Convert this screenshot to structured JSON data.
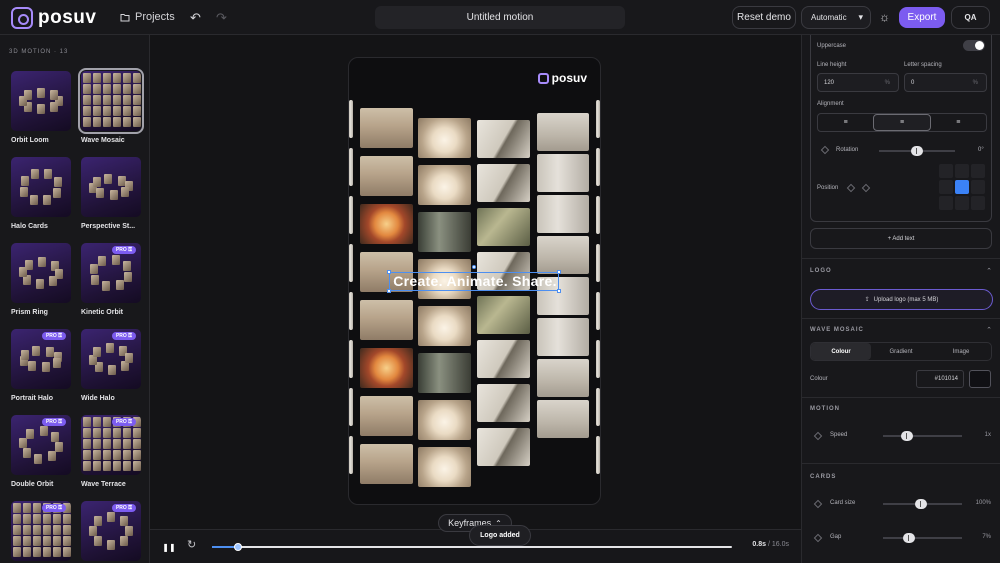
{
  "topbar": {
    "brand": "posuv",
    "projects_label": "Projects",
    "document_title": "Untitled motion",
    "reset_label": "Reset demo",
    "quality_value": "Automatic",
    "export_label": "Export",
    "qa_label": "QA"
  },
  "left_panel": {
    "section_label": "3D MOTION · 13",
    "pro_badge": "PRO ⚿",
    "presets": [
      {
        "label": "Orbit Loom",
        "pro": false,
        "selected": false
      },
      {
        "label": "Wave Mosaic",
        "pro": false,
        "selected": true
      },
      {
        "label": "Halo Cards",
        "pro": false,
        "selected": false
      },
      {
        "label": "Perspective St...",
        "pro": false,
        "selected": false
      },
      {
        "label": "Prism Ring",
        "pro": false,
        "selected": false
      },
      {
        "label": "Kinetic Orbit",
        "pro": true,
        "selected": false
      },
      {
        "label": "Portrait Halo",
        "pro": true,
        "selected": false
      },
      {
        "label": "Wide Halo",
        "pro": true,
        "selected": false
      },
      {
        "label": "Double Orbit",
        "pro": true,
        "selected": false
      },
      {
        "label": "Wave Terrace",
        "pro": true,
        "selected": false
      },
      {
        "label": "",
        "pro": true,
        "selected": false
      },
      {
        "label": "",
        "pro": true,
        "selected": false
      }
    ]
  },
  "canvas": {
    "brand": "posuv",
    "overlay_text": "Create. Animate. Share.",
    "keyframes_label": "Keyframes",
    "toast": "Logo added"
  },
  "timeline": {
    "current_time": "0.8s",
    "total_time": "/ 16.0s",
    "progress": 0.05
  },
  "right_panel": {
    "text_settings": {
      "uppercase_label": "Uppercase",
      "uppercase_on": false,
      "line_height_label": "Line height",
      "line_height_value": "120",
      "line_height_unit": "%",
      "letter_spacing_label": "Letter spacing",
      "letter_spacing_value": "0",
      "letter_spacing_unit": "%",
      "alignment_label": "Alignment",
      "rotation_label": "Rotation",
      "rotation_value": "0°",
      "position_label": "Position",
      "add_text_label": "+ Add text"
    },
    "logo": {
      "header": "LOGO",
      "upload_label": "Upload logo (max 5 MB)"
    },
    "wave_mosaic": {
      "header": "WAVE MOSAIC",
      "tabs": [
        "Colour",
        "Gradient",
        "Image"
      ],
      "active_tab": "Colour",
      "colour_label": "Colour",
      "colour_hex": "#101014"
    },
    "motion": {
      "header": "MOTION",
      "speed_label": "Speed",
      "speed_value": "1x"
    },
    "cards": {
      "header": "CARDS",
      "card_size_label": "Card size",
      "card_size_value": "100%",
      "gap_label": "Gap",
      "gap_value": "7%"
    }
  },
  "colors": {
    "accent": "#7c5cf0",
    "selection": "#4d8ff0",
    "background": "#141416"
  }
}
